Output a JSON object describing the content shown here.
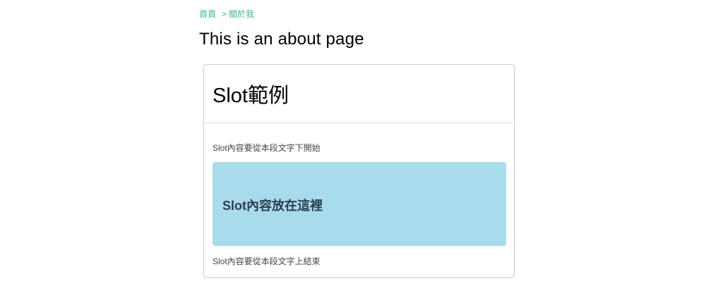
{
  "breadcrumb": {
    "home": "首頁",
    "separator": ">",
    "current": "關於我"
  },
  "page": {
    "title": "This is an about page"
  },
  "card": {
    "title": "Slot範例",
    "note_top": "Slot內容要從本段文字下開始",
    "slot_text": "Slot內容放在這裡",
    "note_bottom": "Slot內容要從本段文字上結束"
  },
  "colors": {
    "link": "#42b983",
    "slot_background": "#a8dbec",
    "slot_text": "#2c3e50"
  }
}
